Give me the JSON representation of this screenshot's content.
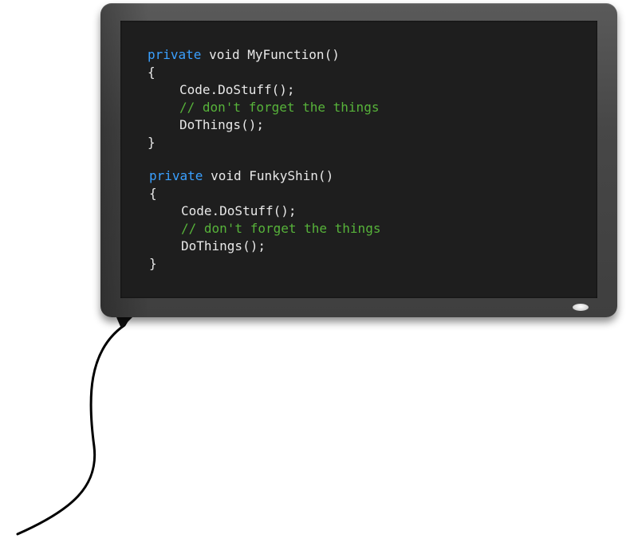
{
  "colors": {
    "screen_background": "#1e1e1e",
    "keyword": "#3aa0ff",
    "comment": "#57b33a",
    "plain_text": "#e8e8e8",
    "bezel": "#474747",
    "cable": "#000000"
  },
  "screen": {
    "code_blocks": [
      {
        "signature_keyword": "private",
        "signature_rest": " void MyFunction()",
        "open_brace": "{",
        "body_lines": [
          {
            "type": "plain",
            "text": "Code.DoStuff();"
          },
          {
            "type": "comment",
            "text": "// don't forget the things"
          },
          {
            "type": "plain",
            "text": "DoThings();"
          }
        ],
        "close_brace": "}"
      },
      {
        "signature_keyword": "private",
        "signature_rest": " void FunkyShin()",
        "open_brace": "{",
        "body_lines": [
          {
            "type": "plain",
            "text": "Code.DoStuff();"
          },
          {
            "type": "comment",
            "text": "// don't forget the things"
          },
          {
            "type": "plain",
            "text": "DoThings();"
          }
        ],
        "close_brace": "}"
      }
    ]
  },
  "icons": {
    "power_indicator": "power-led-icon",
    "cable": "cable-icon"
  }
}
